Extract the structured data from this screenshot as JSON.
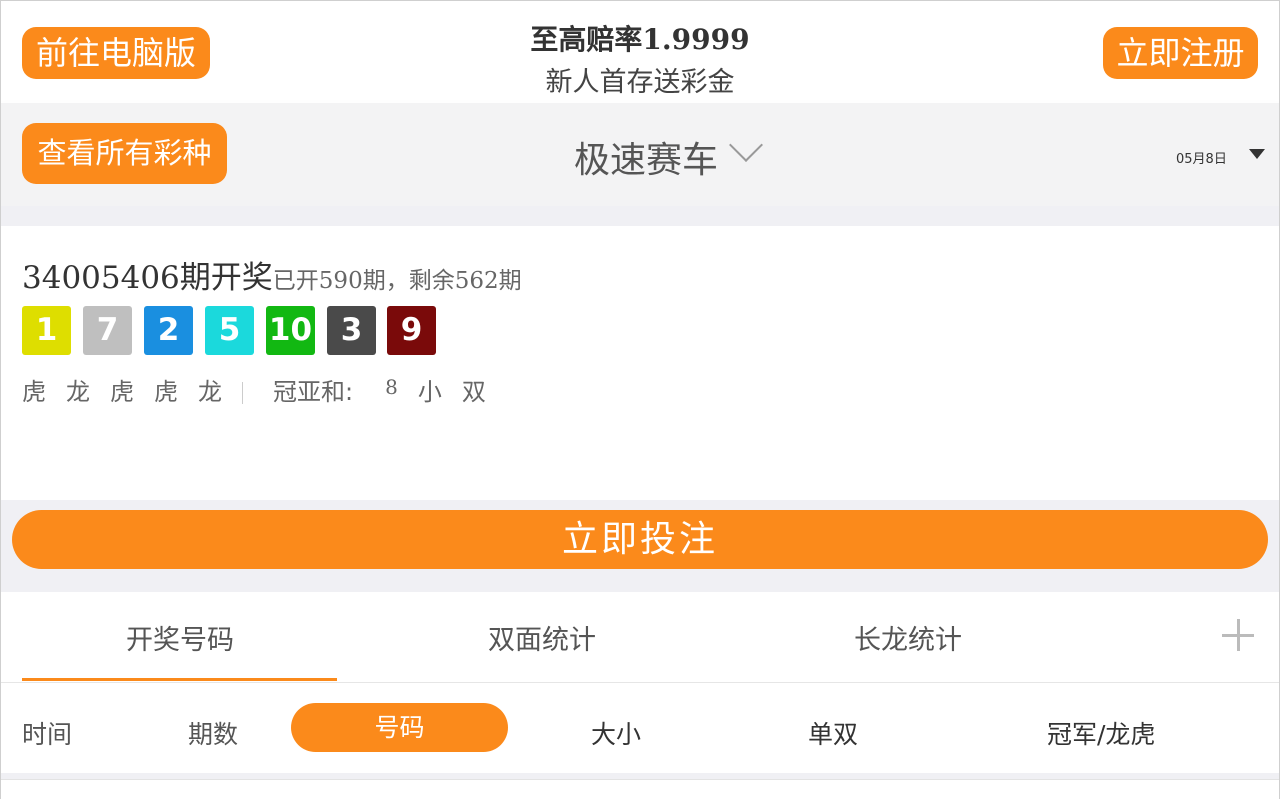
{
  "header": {
    "pc_button": "前往电脑版",
    "promo_title": "至高赔率1.9999",
    "promo_sub": "新人首存送彩金",
    "register_button": "立即注册"
  },
  "selector": {
    "all_button": "查看所有彩种",
    "lottery_name": "极速赛车",
    "date": "05月8日"
  },
  "draw": {
    "issue": "34005406期开奖",
    "progress": "已开590期，剩余562期",
    "balls": [
      {
        "num": "1",
        "color": "#dede00"
      },
      {
        "num": "7",
        "color": "#bfbfbf"
      },
      {
        "num": "2",
        "color": "#1a8fe0"
      },
      {
        "num": "5",
        "color": "#1bd9dc"
      },
      {
        "num": "10",
        "color": "#12b812"
      },
      {
        "num": "3",
        "color": "#4a4a4a"
      },
      {
        "num": "9",
        "color": "#7a0a0a"
      }
    ],
    "dragon_tiger": [
      "虎",
      "龙",
      "虎",
      "虎",
      "龙"
    ],
    "sum_label": "冠亚和:",
    "sum_value": "8",
    "sum_size": "小",
    "sum_parity": "双"
  },
  "bet_button": "立即投注",
  "tabs": [
    "开奖号码",
    "双面统计",
    "长龙统计"
  ],
  "sub_filters": [
    "时间",
    "期数",
    "号码",
    "大小",
    "单双",
    "冠军/龙虎"
  ],
  "colors": {
    "accent": "#fb8a1b"
  }
}
